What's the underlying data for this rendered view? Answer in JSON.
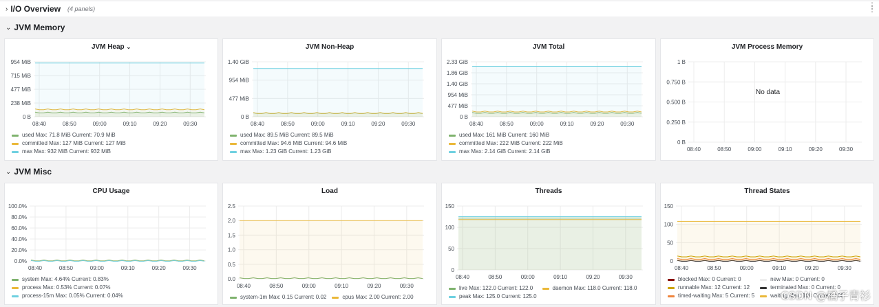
{
  "io_row": {
    "title": "I/O Overview",
    "meta": "(4 panels)"
  },
  "jvm_memory_row": {
    "title": "JVM Memory"
  },
  "jvm_misc_row": {
    "title": "JVM Misc"
  },
  "watermark": "CSDN @橘子青衫",
  "colors": {
    "green": "#7eb26d",
    "yellow": "#eab839",
    "blue": "#6ed0e0",
    "orange": "#ef843c",
    "red": "#890f02",
    "darkyellow": "#cca300"
  },
  "panels": {
    "heap": {
      "title": "JVM Heap",
      "y_ticks": [
        "954 MiB",
        "715 MiB",
        "477 MiB",
        "238 MiB",
        "0 B"
      ],
      "x_ticks": [
        "08:40",
        "08:50",
        "09:00",
        "09:10",
        "09:20",
        "09:30"
      ],
      "legend": [
        {
          "label": "used",
          "text": "Max: 71.8 MiB  Current: 70.9 MiB",
          "color": "#7eb26d"
        },
        {
          "label": "committed",
          "text": "Max: 127 MiB  Current: 127 MiB",
          "color": "#eab839"
        },
        {
          "label": "max",
          "text": "Max: 932 MiB  Current: 932 MiB",
          "color": "#6ed0e0"
        }
      ]
    },
    "nonheap": {
      "title": "JVM Non-Heap",
      "y_ticks": [
        "1.40 GiB",
        "954 MiB",
        "477 MiB",
        "0 B"
      ],
      "x_ticks": [
        "08:40",
        "08:50",
        "09:00",
        "09:10",
        "09:20",
        "09:30"
      ],
      "legend": [
        {
          "label": "used",
          "text": "Max: 89.5 MiB  Current: 89.5 MiB",
          "color": "#7eb26d"
        },
        {
          "label": "committed",
          "text": "Max: 94.6 MiB  Current: 94.6 MiB",
          "color": "#eab839"
        },
        {
          "label": "max",
          "text": "Max: 1.23 GiB  Current: 1.23 GiB",
          "color": "#6ed0e0"
        }
      ]
    },
    "total": {
      "title": "JVM Total",
      "y_ticks": [
        "2.33 GiB",
        "1.86 GiB",
        "1.40 GiB",
        "954 MiB",
        "477 MiB",
        "0 B"
      ],
      "x_ticks": [
        "08:40",
        "08:50",
        "09:00",
        "09:10",
        "09:20",
        "09:30"
      ],
      "legend": [
        {
          "label": "used",
          "text": "Max: 161 MiB  Current: 160 MiB",
          "color": "#7eb26d"
        },
        {
          "label": "committed",
          "text": "Max: 222 MiB  Current: 222 MiB",
          "color": "#eab839"
        },
        {
          "label": "max",
          "text": "Max: 2.14 GiB  Current: 2.14 GiB",
          "color": "#6ed0e0"
        }
      ]
    },
    "process_memory": {
      "title": "JVM Process Memory",
      "y_ticks": [
        "1 B",
        "0.750 B",
        "0.500 B",
        "0.250 B",
        "0 B"
      ],
      "x_ticks": [
        "08:40",
        "08:50",
        "09:00",
        "09:10",
        "09:20",
        "09:30"
      ],
      "no_data": "No data"
    },
    "cpu": {
      "title": "CPU Usage",
      "y_ticks": [
        "100.0%",
        "80.0%",
        "60.0%",
        "40.0%",
        "20.0%",
        "0.0%"
      ],
      "x_ticks": [
        "08:40",
        "08:50",
        "09:00",
        "09:10",
        "09:20",
        "09:30"
      ],
      "legend": [
        {
          "label": "system",
          "text": "Max: 4.64%  Current: 0.83%",
          "color": "#7eb26d"
        },
        {
          "label": "process",
          "text": "Max: 0.53%  Current: 0.07%",
          "color": "#eab839"
        },
        {
          "label": "process-15m",
          "text": "Max: 0.05%  Current: 0.04%",
          "color": "#6ed0e0"
        }
      ]
    },
    "load": {
      "title": "Load",
      "y_ticks": [
        "2.5",
        "2.0",
        "1.5",
        "1.0",
        "0.5",
        "0.0"
      ],
      "x_ticks": [
        "08:40",
        "08:50",
        "09:00",
        "09:10",
        "09:20",
        "09:30"
      ],
      "legend": [
        {
          "label": "system-1m",
          "text": "Max: 0.15  Current: 0.02",
          "color": "#7eb26d"
        },
        {
          "label": "cpus",
          "text": "Max: 2.00  Current: 2.00",
          "color": "#eab839"
        }
      ]
    },
    "threads": {
      "title": "Threads",
      "y_ticks": [
        "150",
        "100",
        "50",
        "0"
      ],
      "x_ticks": [
        "08:40",
        "08:50",
        "09:00",
        "09:10",
        "09:20",
        "09:30"
      ],
      "legend": [
        {
          "label": "live",
          "text": "Max: 122.0  Current: 122.0",
          "color": "#7eb26d"
        },
        {
          "label": "daemon",
          "text": "Max: 118.0  Current: 118.0",
          "color": "#eab839"
        },
        {
          "label": "peak",
          "text": "Max: 125.0  Current: 125.0",
          "color": "#6ed0e0"
        }
      ]
    },
    "thread_states": {
      "title": "Thread States",
      "y_ticks": [
        "150",
        "100",
        "50",
        "0"
      ],
      "x_ticks": [
        "08:40",
        "08:50",
        "09:00",
        "09:10",
        "09:20",
        "09:30"
      ],
      "legend": [
        {
          "label": "blocked",
          "text": "Max: 0  Current: 0",
          "color": "#890f02"
        },
        {
          "label": "new",
          "text": "Max: 0  Current: 0",
          "color": "#eeeeee"
        },
        {
          "label": "runnable",
          "text": "Max: 12  Current: 12",
          "color": "#cca300"
        },
        {
          "label": "terminated",
          "text": "Max: 0  Current: 0",
          "color": "#333333"
        },
        {
          "label": "timed-waiting",
          "text": "Max: 5  Current: 5",
          "color": "#ef843c"
        },
        {
          "label": "waiting",
          "text": "Max: 108  Current: 108",
          "color": "#eab839"
        }
      ]
    }
  },
  "chart_data": [
    {
      "type": "area",
      "title": "JVM Heap",
      "series": [
        {
          "name": "used",
          "values": [
            71.8,
            70.9
          ]
        },
        {
          "name": "committed",
          "values": [
            127,
            127
          ]
        },
        {
          "name": "max",
          "values": [
            932,
            932
          ]
        }
      ],
      "ylim": [
        0,
        954
      ]
    },
    {
      "type": "area",
      "title": "JVM Non-Heap",
      "series": [
        {
          "name": "used",
          "values": [
            89.5,
            89.5
          ]
        },
        {
          "name": "committed",
          "values": [
            94.6,
            94.6
          ]
        },
        {
          "name": "max",
          "values": [
            1259.5,
            1259.5
          ]
        }
      ],
      "ylim": [
        0,
        1433.6
      ]
    },
    {
      "type": "area",
      "title": "JVM Total",
      "series": [
        {
          "name": "used",
          "values": [
            161,
            160
          ]
        },
        {
          "name": "committed",
          "values": [
            222,
            222
          ]
        },
        {
          "name": "max",
          "values": [
            2191.4,
            2191.4
          ]
        }
      ],
      "ylim": [
        0,
        2385.9
      ]
    },
    {
      "type": "line",
      "title": "JVM Process Memory",
      "series": [],
      "ylim": [
        0,
        1
      ]
    },
    {
      "type": "line",
      "title": "CPU Usage",
      "series": [
        {
          "name": "system",
          "values": [
            0.83,
            0.83
          ]
        },
        {
          "name": "process",
          "values": [
            0.07,
            0.07
          ]
        },
        {
          "name": "process-15m",
          "values": [
            0.04,
            0.04
          ]
        }
      ],
      "ylim": [
        0,
        100
      ]
    },
    {
      "type": "area",
      "title": "Load",
      "series": [
        {
          "name": "system-1m",
          "values": [
            0.02,
            0.02
          ]
        },
        {
          "name": "cpus",
          "values": [
            2,
            2
          ]
        }
      ],
      "ylim": [
        0,
        2.5
      ]
    },
    {
      "type": "area",
      "title": "Threads",
      "series": [
        {
          "name": "live",
          "values": [
            122,
            122
          ]
        },
        {
          "name": "daemon",
          "values": [
            118,
            118
          ]
        },
        {
          "name": "peak",
          "values": [
            125,
            125
          ]
        }
      ],
      "ylim": [
        0,
        150
      ]
    },
    {
      "type": "area",
      "title": "Thread States",
      "series": [
        {
          "name": "blocked",
          "values": [
            0,
            0
          ]
        },
        {
          "name": "new",
          "values": [
            0,
            0
          ]
        },
        {
          "name": "runnable",
          "values": [
            12,
            12
          ]
        },
        {
          "name": "terminated",
          "values": [
            0,
            0
          ]
        },
        {
          "name": "timed-waiting",
          "values": [
            5,
            5
          ]
        },
        {
          "name": "waiting",
          "values": [
            108,
            108
          ]
        }
      ],
      "ylim": [
        0,
        150
      ]
    }
  ]
}
